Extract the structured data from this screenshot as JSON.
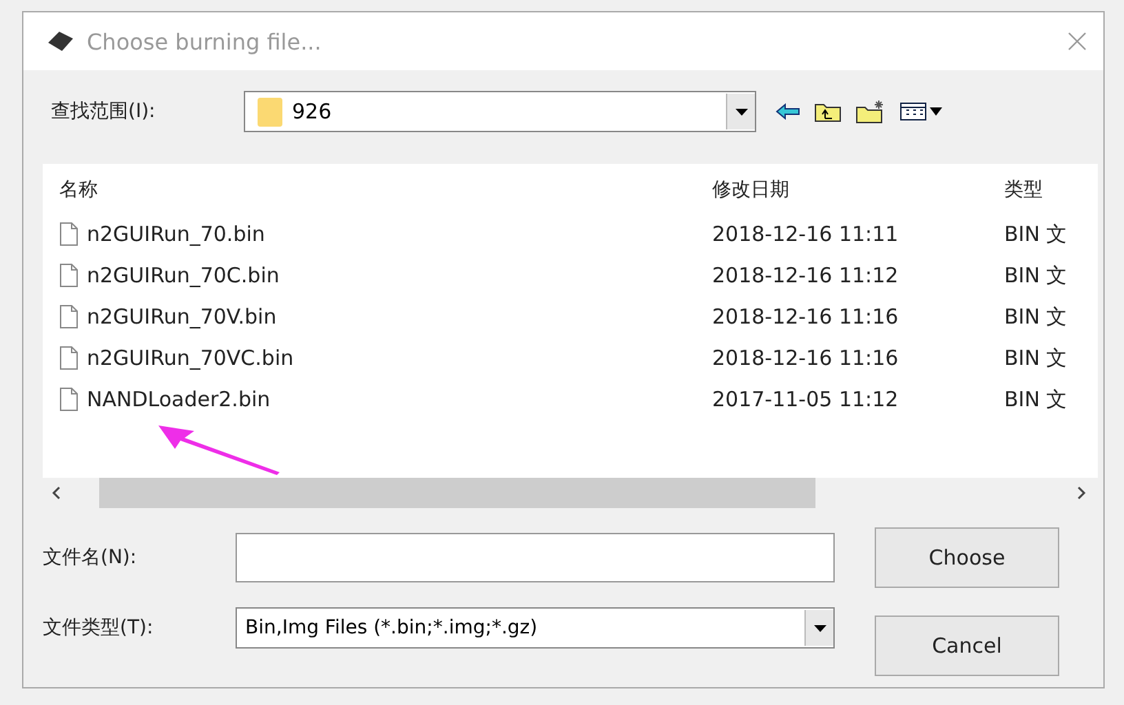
{
  "window": {
    "title": "Choose burning file..."
  },
  "look_in": {
    "label": "查找范围(I):",
    "value": "926"
  },
  "file_list": {
    "columns": [
      "名称",
      "修改日期",
      "类型"
    ],
    "rows": [
      {
        "name": "n2GUIRun_70.bin",
        "modified": "2018-12-16 11:11",
        "type": "BIN 文"
      },
      {
        "name": "n2GUIRun_70C.bin",
        "modified": "2018-12-16 11:12",
        "type": "BIN 文"
      },
      {
        "name": "n2GUIRun_70V.bin",
        "modified": "2018-12-16 11:16",
        "type": "BIN 文"
      },
      {
        "name": "n2GUIRun_70VC.bin",
        "modified": "2018-12-16 11:16",
        "type": "BIN 文"
      },
      {
        "name": "NANDLoader2.bin",
        "modified": "2017-11-05 11:12",
        "type": "BIN 文"
      }
    ]
  },
  "file_name": {
    "label": "文件名(N):"
  },
  "file_type": {
    "label": "文件类型(T):",
    "value": "Bin,Img Files  (*.bin;*.img;*.gz)"
  },
  "buttons": [
    "Choose",
    "Cancel"
  ]
}
